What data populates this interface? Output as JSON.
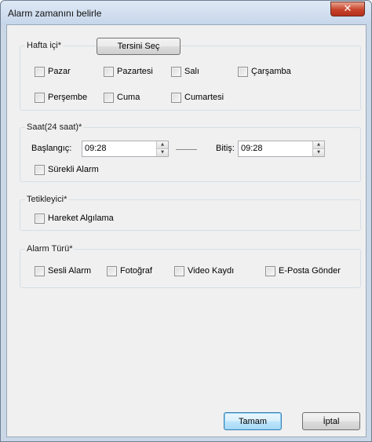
{
  "window": {
    "title": "Alarm zamanını belirle",
    "close_glyph": "✕"
  },
  "weekdays": {
    "label": "Hafta içi*",
    "invert_button": "Tersini Seç",
    "days": [
      "Pazar",
      "Pazartesi",
      "Salı",
      "Çarşamba",
      "Perşembe",
      "Cuma",
      "Cumartesi"
    ]
  },
  "time": {
    "label": "Saat(24 saat)*",
    "start_label": "Başlangıç:",
    "start_value": "09:28",
    "end_label": "Bitiş:",
    "end_value": "09:28",
    "continuous_label": "Sürekli Alarm"
  },
  "trigger": {
    "label": "Tetikleyici*",
    "motion_label": "Hareket Algılama"
  },
  "alarm_type": {
    "label": "Alarm Türü*",
    "options": [
      "Sesli Alarm",
      "Fotoğraf",
      "Video Kaydı",
      "E-Posta Gönder"
    ]
  },
  "footer": {
    "ok": "Tamam",
    "cancel": "İptal"
  }
}
